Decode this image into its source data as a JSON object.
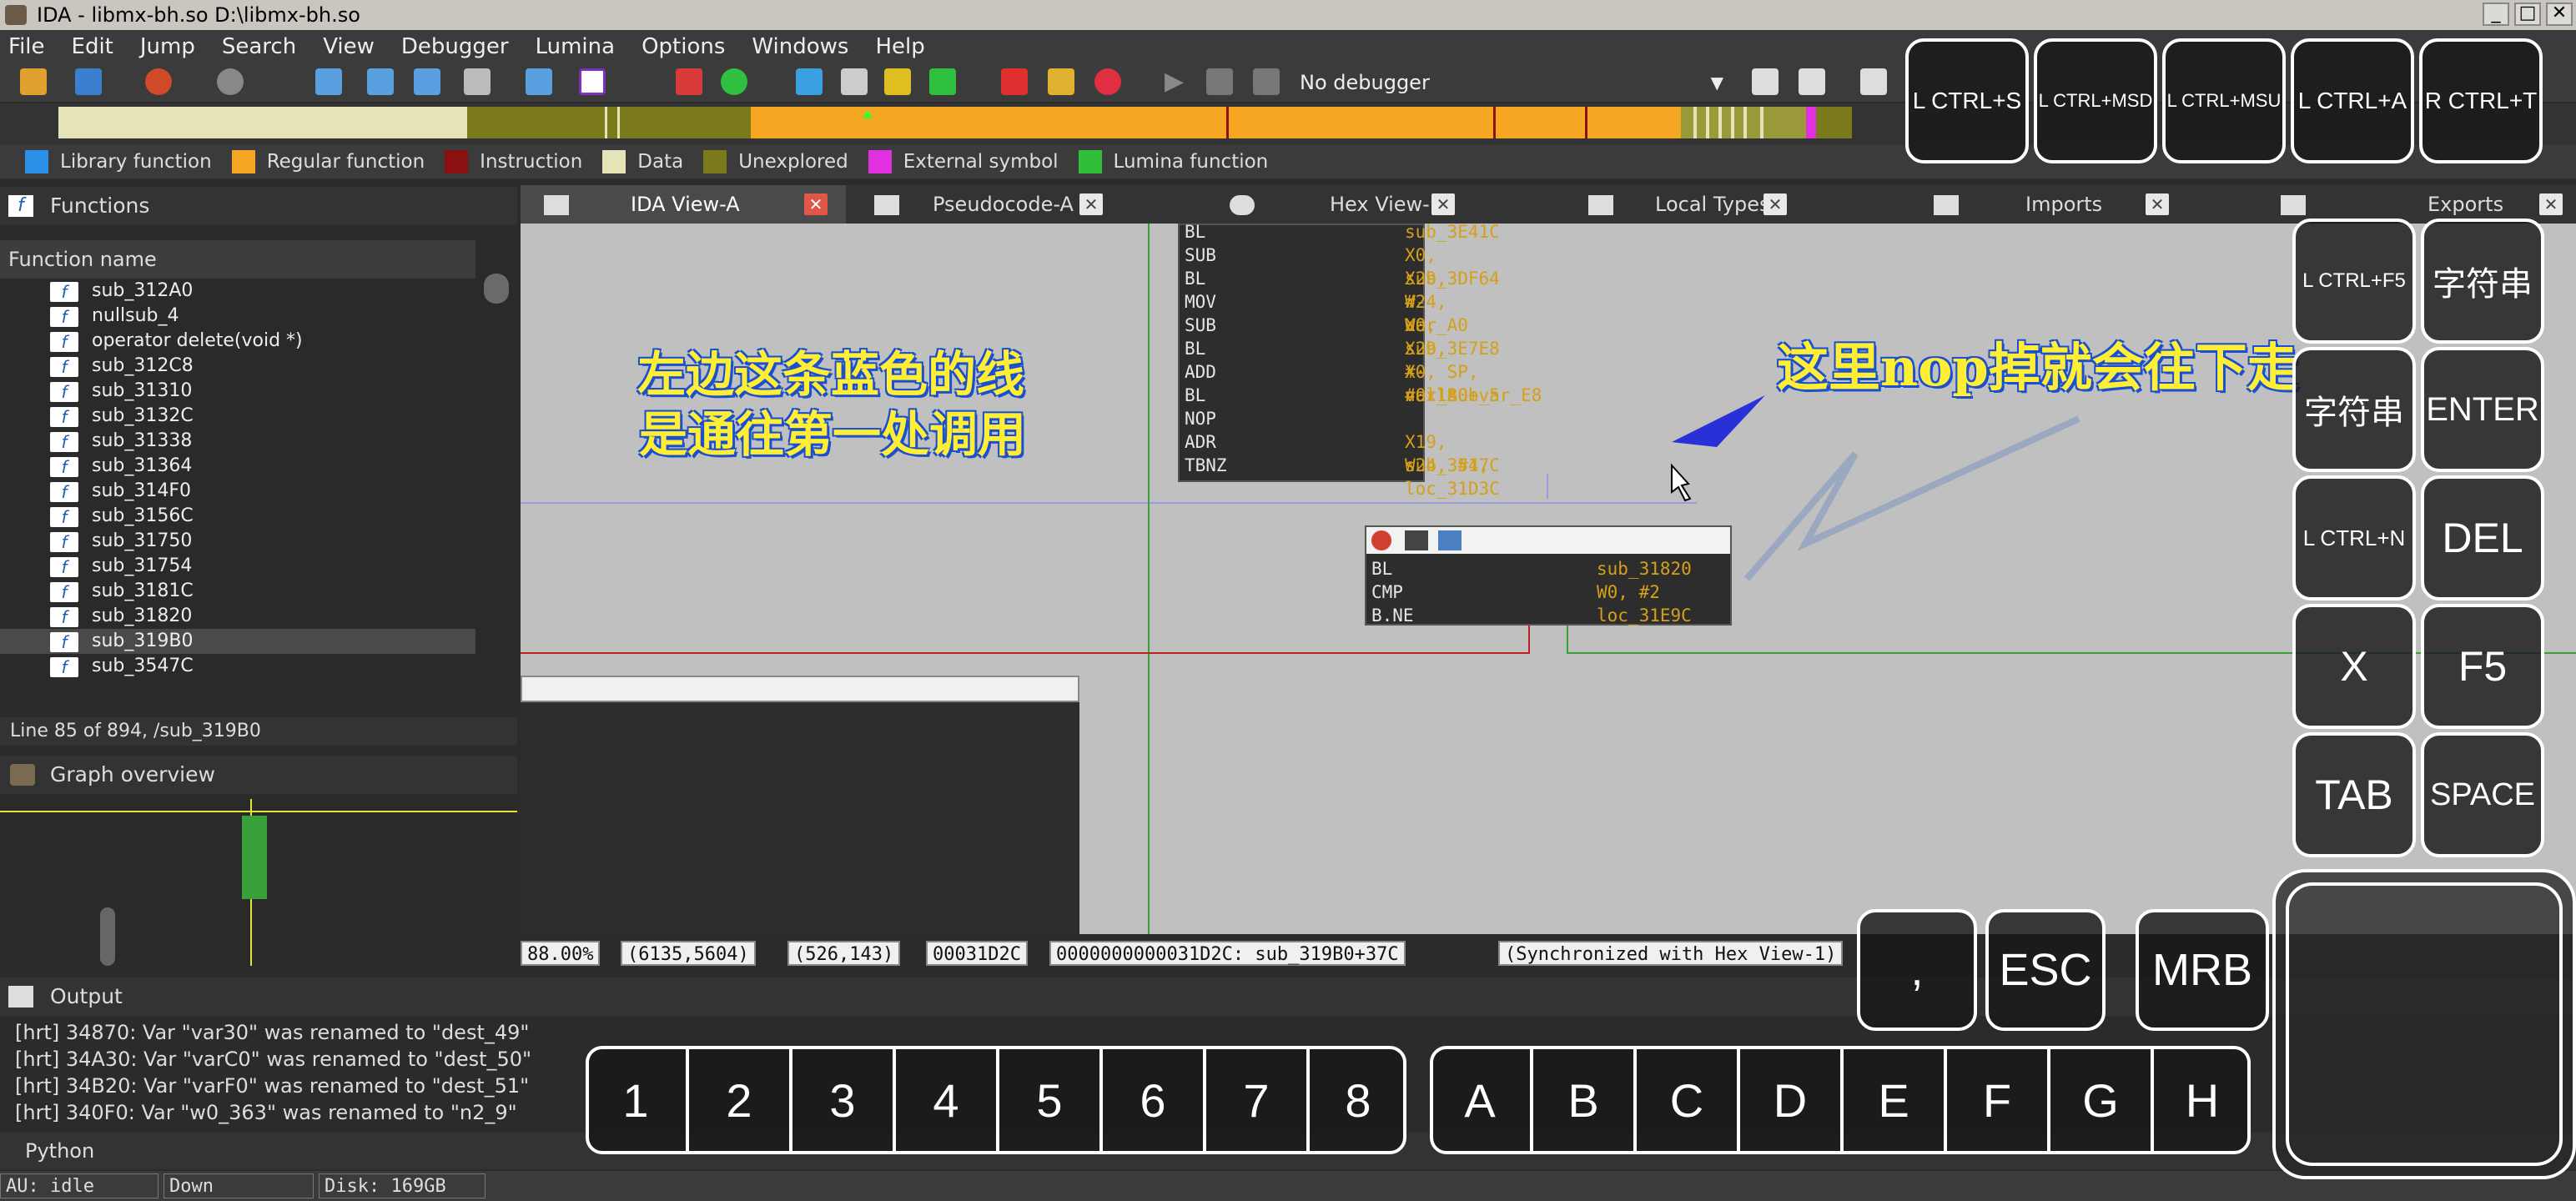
{
  "window": {
    "title": "IDA - libmx-bh.so D:\\libmx-bh.so",
    "controls": [
      "_",
      "□",
      "✕"
    ]
  },
  "menu": [
    "File",
    "Edit",
    "Jump",
    "Search",
    "View",
    "Debugger",
    "Lumina",
    "Options",
    "Windows",
    "Help"
  ],
  "toolbar": {
    "debugger": "No debugger"
  },
  "legend": [
    {
      "label": "Library function",
      "color": "#2a8fe6"
    },
    {
      "label": "Regular function",
      "color": "#f5a623"
    },
    {
      "label": "Instruction",
      "color": "#8b1010"
    },
    {
      "label": "Data",
      "color": "#e4e4b8"
    },
    {
      "label": "Unexplored",
      "color": "#7a7a1a"
    },
    {
      "label": "External symbol",
      "color": "#e030e0"
    },
    {
      "label": "Lumina function",
      "color": "#2fbf3a"
    }
  ],
  "functions": {
    "title": "Functions",
    "column": "Function name",
    "items": [
      "sub_312A0",
      "nullsub_4",
      "operator delete(void *)",
      "sub_312C8",
      "sub_31310",
      "sub_3132C",
      "sub_31338",
      "sub_31364",
      "sub_314F0",
      "sub_3156C",
      "sub_31750",
      "sub_31754",
      "sub_3181C",
      "sub_31820",
      "sub_319B0",
      "sub_3547C"
    ],
    "selected_index": 14,
    "status": "Line 85 of 894, /sub_319B0"
  },
  "graph_overview": {
    "title": "Graph overview"
  },
  "tabs": [
    {
      "label": "IDA View-A",
      "active": true
    },
    {
      "label": "Pseudocode-A",
      "active": false
    },
    {
      "label": "Hex View-1",
      "active": false
    },
    {
      "label": "Local Types",
      "active": false
    },
    {
      "label": "Imports",
      "active": false
    },
    {
      "label": "Exports",
      "active": false
    }
  ],
  "block1": [
    {
      "op": "BL",
      "arg": "sub_3E41C"
    },
    {
      "op": "SUB",
      "arg": "X0, X29, #-var_A0"
    },
    {
      "op": "BL",
      "arg": "sub_3DF64"
    },
    {
      "op": "MOV",
      "arg": "W24, W0"
    },
    {
      "op": "SUB",
      "arg": "X0, X29, #-var_A0"
    },
    {
      "op": "BL",
      "arg": "sub_3E7E8"
    },
    {
      "op": "ADD",
      "arg": "X0, SP, #0x1B0+var_E8"
    },
    {
      "op": "BL",
      "arg": "nullsub_5"
    },
    {
      "op": "NOP",
      "arg": ""
    },
    {
      "op": "ADR",
      "arg": "X19, sub_3547C"
    },
    {
      "op": "TBNZ",
      "arg": "W24, #1, loc_31D3C"
    }
  ],
  "block2": [
    {
      "op": "BL",
      "arg": "sub_31820"
    },
    {
      "op": "CMP",
      "arg": "W0, #2"
    },
    {
      "op": "B.NE",
      "arg": "loc_31E9C"
    }
  ],
  "graph_status": [
    "88.00%",
    "(6135,5604)",
    "(526,143)",
    "00031D2C",
    "0000000000031D2C: sub_319B0+37C",
    "(Synchronized with Hex View-1)"
  ],
  "annotations": {
    "left_line1": "左边这条蓝色的线",
    "left_line2": "是通往第一处调用",
    "right": "这里nop掉就会往下走"
  },
  "output": {
    "title": "Output",
    "lines": [
      "[hrt] 34870: Var \"var30\" was renamed to \"dest_49\"",
      "[hrt] 34A30: Var \"varC0\" was renamed to \"dest_50\"",
      "[hrt] 34B20: Var \"varF0\" was renamed to \"dest_51\"",
      "[hrt] 340F0: Var \"w0_363\" was renamed to \"n2_9\""
    ],
    "python_label": "Python"
  },
  "statusbar": {
    "au": "AU:  idle",
    "direction": "Down",
    "disk": "Disk: 169GB"
  },
  "keys": {
    "top": [
      "L CTRL+S",
      "L CTRL+MSD",
      "L CTRL+MSU",
      "L CTRL+A",
      "R CTRL+T"
    ],
    "side": [
      "L CTRL+F5",
      "字符串",
      "字符串",
      "ENTER",
      "L CTRL+N",
      "DEL",
      "X",
      "F5",
      "TAB",
      "SPACE"
    ],
    "mid": [
      ",",
      "ESC",
      "MRB"
    ],
    "numbers": [
      "1",
      "2",
      "3",
      "4",
      "5",
      "6",
      "7",
      "8"
    ],
    "letters": [
      "A",
      "B",
      "C",
      "D",
      "E",
      "F",
      "G",
      "H"
    ]
  }
}
